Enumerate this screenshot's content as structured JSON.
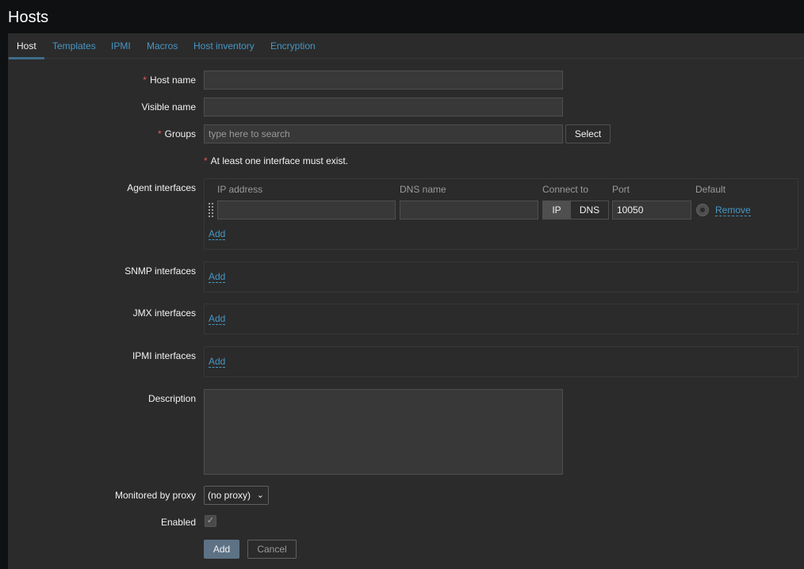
{
  "page": {
    "title": "Hosts"
  },
  "tabs": [
    {
      "label": "Host"
    },
    {
      "label": "Templates"
    },
    {
      "label": "IPMI"
    },
    {
      "label": "Macros"
    },
    {
      "label": "Host inventory"
    },
    {
      "label": "Encryption"
    }
  ],
  "form": {
    "required_mark": "*",
    "host_name": {
      "label": "Host name",
      "value": ""
    },
    "visible_name": {
      "label": "Visible name",
      "value": ""
    },
    "groups": {
      "label": "Groups",
      "placeholder": "type here to search",
      "select_label": "Select"
    },
    "interface_note": "At least one interface must exist.",
    "agent_interfaces": {
      "label": "Agent interfaces",
      "columns": [
        "IP address",
        "DNS name",
        "Connect to",
        "Port",
        "Default"
      ],
      "row": {
        "ip": "",
        "dns": "",
        "connect_ip": "IP",
        "connect_dns": "DNS",
        "port": "10050",
        "remove": "Remove"
      },
      "add": "Add"
    },
    "snmp_interfaces": {
      "label": "SNMP interfaces",
      "add": "Add"
    },
    "jmx_interfaces": {
      "label": "JMX interfaces",
      "add": "Add"
    },
    "ipmi_interfaces": {
      "label": "IPMI interfaces",
      "add": "Add"
    },
    "description": {
      "label": "Description",
      "value": ""
    },
    "monitored_by_proxy": {
      "label": "Monitored by proxy",
      "selected": "(no proxy)"
    },
    "enabled": {
      "label": "Enabled",
      "checked": true
    },
    "buttons": {
      "add": "Add",
      "cancel": "Cancel"
    }
  },
  "colors": {
    "accent": "#4796c4",
    "required": "#e45959",
    "panel": "#2b2b2b",
    "primary_button": "#5d7285"
  }
}
